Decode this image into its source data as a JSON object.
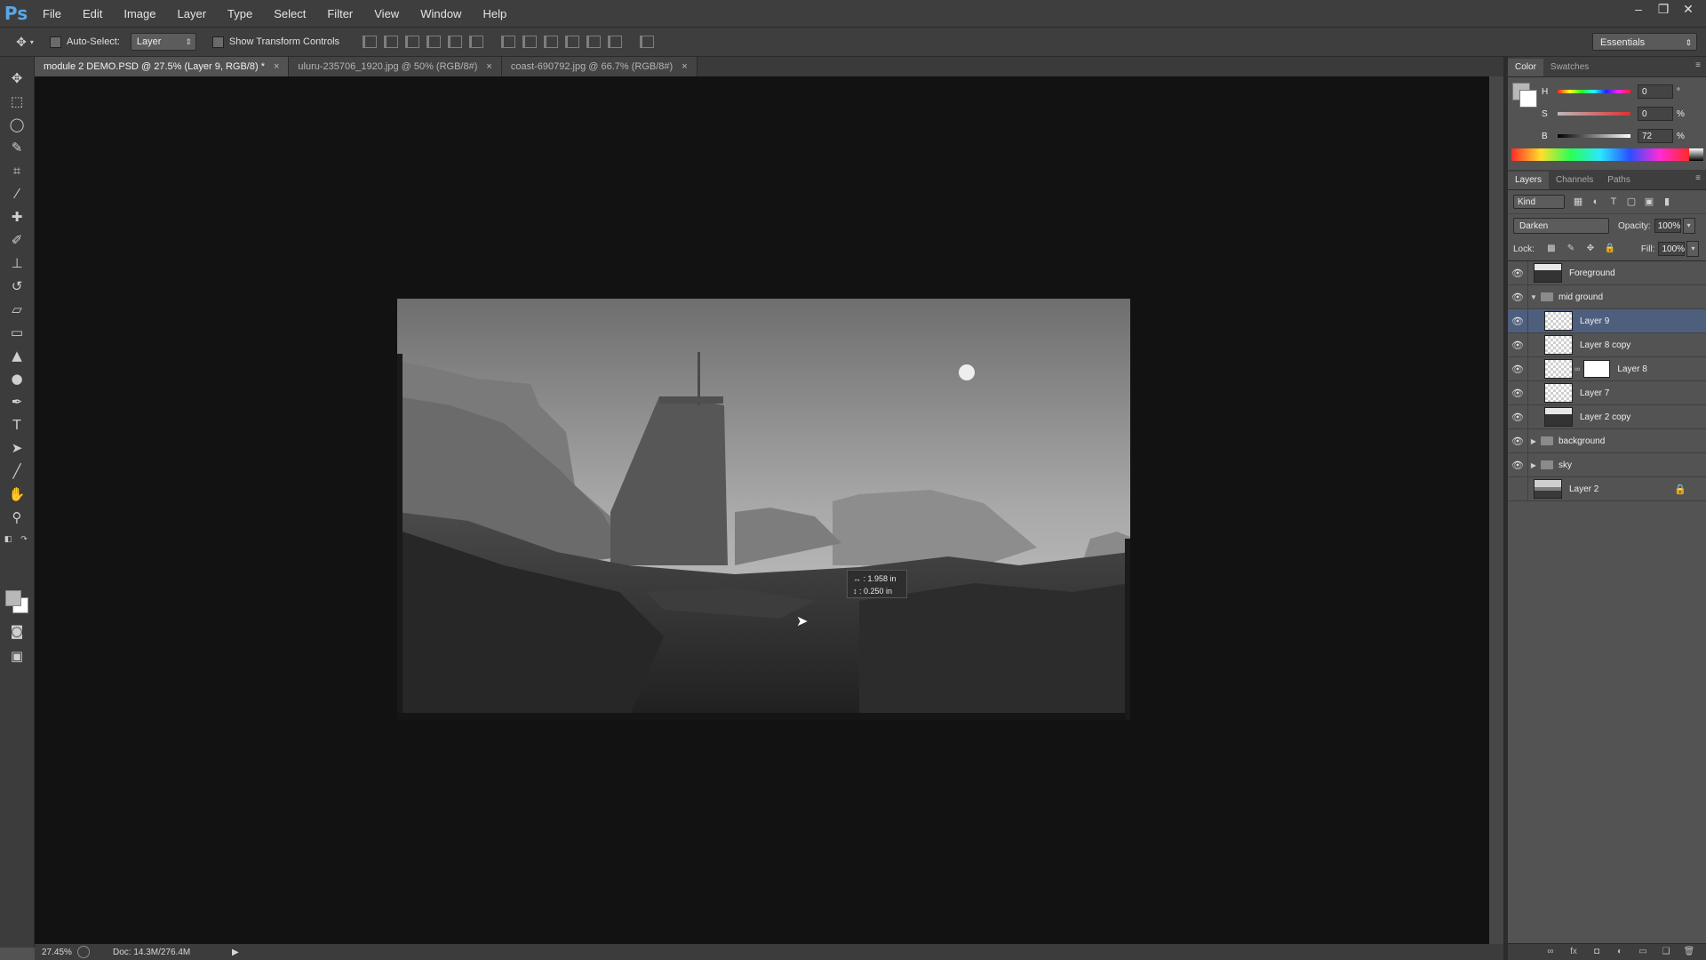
{
  "app": {
    "logo": "Ps"
  },
  "menu": [
    "File",
    "Edit",
    "Image",
    "Layer",
    "Type",
    "Select",
    "Filter",
    "View",
    "Window",
    "Help"
  ],
  "window_controls": {
    "minimize": "–",
    "restore": "❐",
    "close": "✕"
  },
  "options_bar": {
    "tool_glyph": "✥",
    "auto_select_label": "Auto-Select:",
    "auto_select_target": "Layer",
    "show_transform_label": "Show Transform Controls",
    "workspace": "Essentials"
  },
  "tabs": [
    {
      "label": "module 2 DEMO.PSD @ 27.5% (Layer 9, RGB/8) *",
      "close": "×"
    },
    {
      "label": "uluru-235706_1920.jpg @ 50% (RGB/8#)",
      "close": "×"
    },
    {
      "label": "coast-690792.jpg @ 66.7% (RGB/8#)",
      "close": "×"
    }
  ],
  "canvas": {
    "tooltip_line1": "↔ : 1.958 in",
    "tooltip_line2": "↕ : 0.250 in",
    "cursor_glyph": "➤"
  },
  "status": {
    "zoom": "27.45%",
    "doc": "Doc: 14.3M/276.4M",
    "arrow": "▶"
  },
  "color_panel": {
    "tabs": [
      "Color",
      "Swatches"
    ],
    "h": {
      "label": "H",
      "value": "0",
      "unit": "°"
    },
    "s": {
      "label": "S",
      "value": "0",
      "unit": "%"
    },
    "b": {
      "label": "B",
      "value": "72",
      "unit": "%"
    }
  },
  "layers_panel": {
    "tabs": [
      "Layers",
      "Channels",
      "Paths"
    ],
    "kind": "Kind",
    "blend_mode": "Darken",
    "opacity_label": "Opacity:",
    "opacity_value": "100%",
    "lock_label": "Lock:",
    "fill_label": "Fill:",
    "fill_value": "100%",
    "layers": [
      {
        "name": "Foreground",
        "type": "layer",
        "thumb": "dark",
        "visible": true
      },
      {
        "name": "mid ground",
        "type": "group-open",
        "visible": true
      },
      {
        "name": "Layer 9",
        "type": "layer",
        "thumb": "checker",
        "visible": true,
        "selected": true,
        "indent": true
      },
      {
        "name": "Layer 8 copy",
        "type": "layer",
        "thumb": "checker",
        "visible": true,
        "indent": true
      },
      {
        "name": "Layer 8",
        "type": "masked",
        "thumb": "checker",
        "visible": true,
        "indent": true
      },
      {
        "name": "Layer 7",
        "type": "layer",
        "thumb": "checker",
        "visible": true,
        "indent": true
      },
      {
        "name": "Layer 2 copy",
        "type": "layer",
        "thumb": "dark",
        "visible": true,
        "indent": true
      },
      {
        "name": "background",
        "type": "group",
        "visible": true
      },
      {
        "name": "sky",
        "type": "group",
        "visible": true
      },
      {
        "name": "Layer 2",
        "type": "layer",
        "thumb": "scene",
        "visible": false,
        "locked": true
      }
    ]
  }
}
